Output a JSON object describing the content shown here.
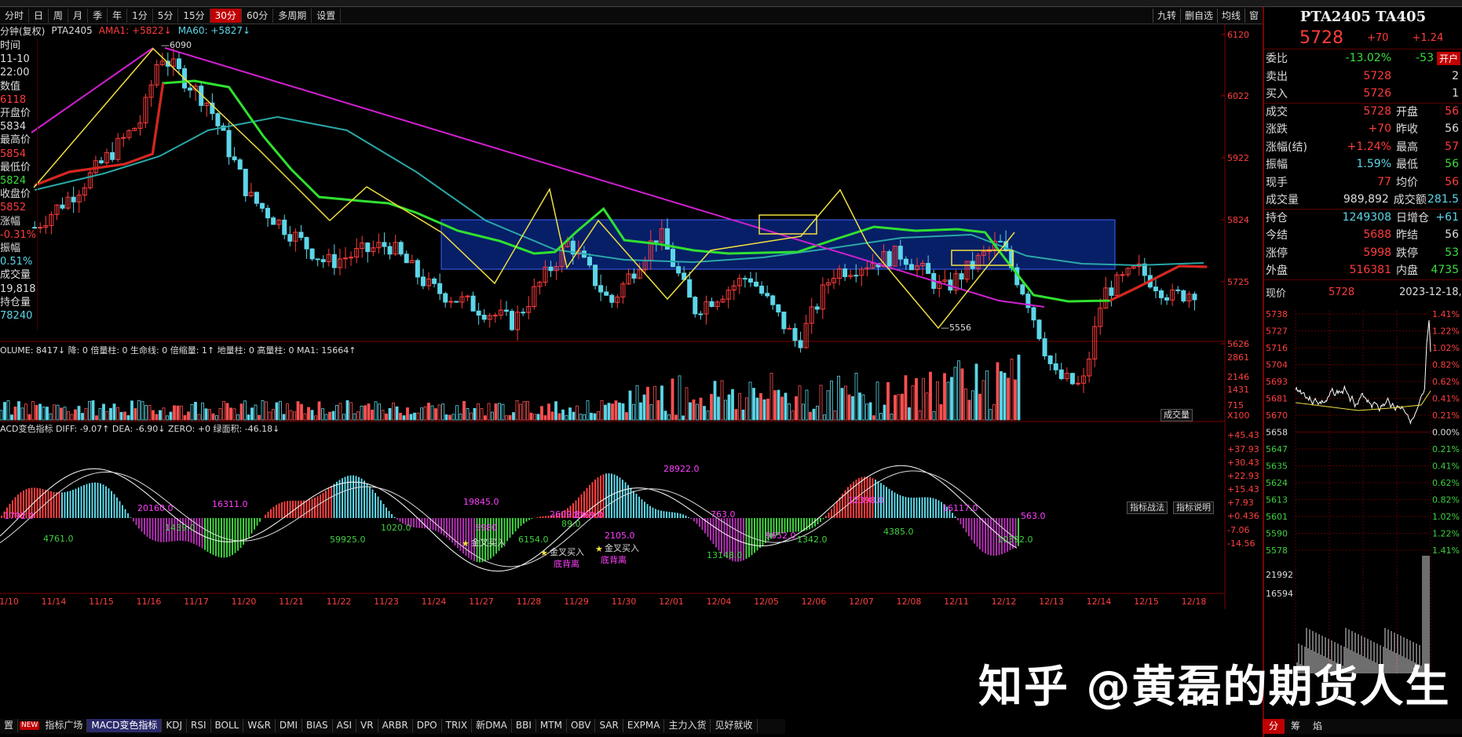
{
  "timeframes": [
    "分时",
    "日",
    "周",
    "月",
    "季",
    "年",
    "1分",
    "5分",
    "15分",
    "30分",
    "60分",
    "多周期",
    "设置"
  ],
  "active_timeframe": "30分",
  "top_right": [
    "九转",
    "删自选",
    "均线",
    "窗"
  ],
  "main_info": {
    "name": "分钟(复权)",
    "code": "PTA2405",
    "ama": "AMA1: +5822↓",
    "ma60": "MA60: +5827↓"
  },
  "left_panel": [
    {
      "t": "时间",
      "c": "lw"
    },
    {
      "t": "11-10",
      "c": "lw"
    },
    {
      "t": "22:00",
      "c": "lw"
    },
    {
      "t": "数值",
      "c": "lw"
    },
    {
      "t": "6118",
      "c": "lr"
    },
    {
      "t": "开盘价",
      "c": "lw"
    },
    {
      "t": "5834",
      "c": "lw"
    },
    {
      "t": "最高价",
      "c": "lw"
    },
    {
      "t": "5854",
      "c": "lr"
    },
    {
      "t": "最低价",
      "c": "lw"
    },
    {
      "t": "5824",
      "c": "lg"
    },
    {
      "t": "收盘价",
      "c": "lw"
    },
    {
      "t": "5852",
      "c": "lr"
    },
    {
      "t": "涨幅",
      "c": "lw"
    },
    {
      "t": "-0.31%",
      "c": "lr"
    },
    {
      "t": "振幅",
      "c": "lw"
    },
    {
      "t": "0.51%",
      "c": "lc"
    },
    {
      "t": "成交量",
      "c": "lw"
    },
    {
      "t": "19,818",
      "c": "lw"
    },
    {
      "t": "持仓量",
      "c": "lw"
    },
    {
      "t": "78240",
      "c": "lc"
    }
  ],
  "price_axis": [
    "6120",
    "6022",
    "5922",
    "5824",
    "5725",
    "5626"
  ],
  "annotations": {
    "high": "6090",
    "low": "5556"
  },
  "volume_info": {
    "label": "OLUME: 8417↓ 降: 0 倍量柱: 0 生命线: 0 倍缩量: 1↑ 地量柱: 0 高量柱: 0 MA1: 15664↑",
    "button": "成交量"
  },
  "volume_axis": [
    "2861",
    "2146",
    "1431",
    "715",
    "X100"
  ],
  "macd_info": {
    "label": "ACD变色指标 DIFF: -9.07↑ DEA: -6.90↓ ZERO: +0 绿面积: -46.18↓",
    "btn1": "指标战法",
    "btn2": "指标说明"
  },
  "macd_axis": [
    "+45.43",
    "+37.93",
    "+30.43",
    "+22.93",
    "+15.43",
    "+7.93",
    "+0.436",
    "-7.06",
    "-14.56"
  ],
  "macd_labels": [
    "1792.0",
    "4761.0",
    "20160.0",
    "1439.0",
    "16311.0",
    "59925.0",
    "1020.0",
    "19845.0",
    "5980",
    "6154.0",
    "2609.0",
    "89.0",
    "2369.0",
    "2105.0",
    "28922.0",
    "13148.0",
    "763.0",
    "9652.0",
    "1342.0",
    "12398.0",
    "4385.0",
    "16117.0",
    "10392.0",
    "563.0"
  ],
  "signals": [
    "金叉买入",
    "金叉买入",
    "金叉买入",
    "底背离",
    "底背离"
  ],
  "dates": [
    "11/10",
    "11/14",
    "11/15",
    "11/16",
    "11/17",
    "11/20",
    "11/21",
    "11/22",
    "11/23",
    "11/24",
    "11/27",
    "11/28",
    "11/29",
    "11/30",
    "12/01",
    "12/04",
    "12/05",
    "12/06",
    "12/07",
    "12/08",
    "12/11",
    "12/12",
    "12/13",
    "12/14",
    "12/15",
    "12/18"
  ],
  "bottom_tabs": [
    "置",
    "指标广场",
    "MACD变色指标",
    "KDJ",
    "RSI",
    "BOLL",
    "W&R",
    "DMI",
    "BIAS",
    "ASI",
    "VR",
    "ARBR",
    "DPO",
    "TRIX",
    "新DMA",
    "BBI",
    "MTM",
    "OBV",
    "SAR",
    "EXPMA",
    "主力入货",
    "见好就收"
  ],
  "bottom_new": "NEW",
  "bottom_selected": "MACD变色指标",
  "quote": {
    "title": "PTA2405 TA405",
    "price": "5728",
    "change": "+70",
    "change_pct": "+1.24",
    "rows1": [
      {
        "k": "委比",
        "v": "-13.02%",
        "vc": "lg",
        "v2": "-53",
        "v2c": "lg",
        "extra": "开户"
      },
      {
        "k": "卖出",
        "v": "5728",
        "vc": "lr",
        "v2": "2",
        "v2c": "lw"
      },
      {
        "k": "买入",
        "v": "5726",
        "vc": "lr",
        "v2": "1",
        "v2c": "lw"
      }
    ],
    "rows2": [
      {
        "k": "成交",
        "v": "5728",
        "vc": "lr",
        "k2": "开盘",
        "v2": "56",
        "v2c": "lr"
      },
      {
        "k": "涨跌",
        "v": "+70",
        "vc": "lr",
        "k2": "昨收",
        "v2": "56",
        "v2c": "lw"
      },
      {
        "k": "涨幅(结)",
        "v": "+1.24%",
        "vc": "lr",
        "k2": "最高",
        "v2": "57",
        "v2c": "lr"
      },
      {
        "k": "振幅",
        "v": "1.59%",
        "vc": "lc",
        "k2": "最低",
        "v2": "56",
        "v2c": "lg"
      },
      {
        "k": "现手",
        "v": "77",
        "vc": "lr",
        "k2": "均价",
        "v2": "56",
        "v2c": "lr"
      },
      {
        "k": "成交量",
        "v": "989,892",
        "vc": "lw",
        "k2": "成交额",
        "v2": "281.5",
        "v2c": "lc"
      }
    ],
    "rows3": [
      {
        "k": "持仓",
        "v": "1249308",
        "vc": "lc",
        "k2": "日增仓",
        "v2": "+61",
        "v2c": "lc"
      },
      {
        "k": "今结",
        "v": "5688",
        "vc": "lr",
        "k2": "昨结",
        "v2": "56",
        "v2c": "lw"
      },
      {
        "k": "涨停",
        "v": "5998",
        "vc": "lr",
        "k2": "跌停",
        "v2": "53",
        "v2c": "lg"
      },
      {
        "k": "外盘",
        "v": "516381",
        "vc": "lr",
        "k2": "内盘",
        "v2": "4735",
        "v2c": "lg"
      }
    ],
    "now_label": "现价",
    "now_value": "5728",
    "now_date": "2023-12-18,",
    "mini_axis_left": [
      "5738",
      "5727",
      "5716",
      "5704",
      "5693",
      "5681",
      "5670",
      "5658",
      "5647",
      "5635",
      "5624",
      "5613",
      "5601",
      "5590",
      "5578"
    ],
    "mini_axis_right": [
      "1.41%",
      "1.22%",
      "1.02%",
      "0.82%",
      "0.62%",
      "0.41%",
      "0.21%",
      "0.00%",
      "0.21%",
      "0.41%",
      "0.62%",
      "0.82%",
      "1.02%",
      "1.22%",
      "1.41%"
    ],
    "mini_vol": [
      "21992",
      "16594"
    ],
    "mini_tabs": [
      "分",
      "筹",
      "焰"
    ]
  },
  "watermark": "知乎 @黄磊的期货人生"
}
